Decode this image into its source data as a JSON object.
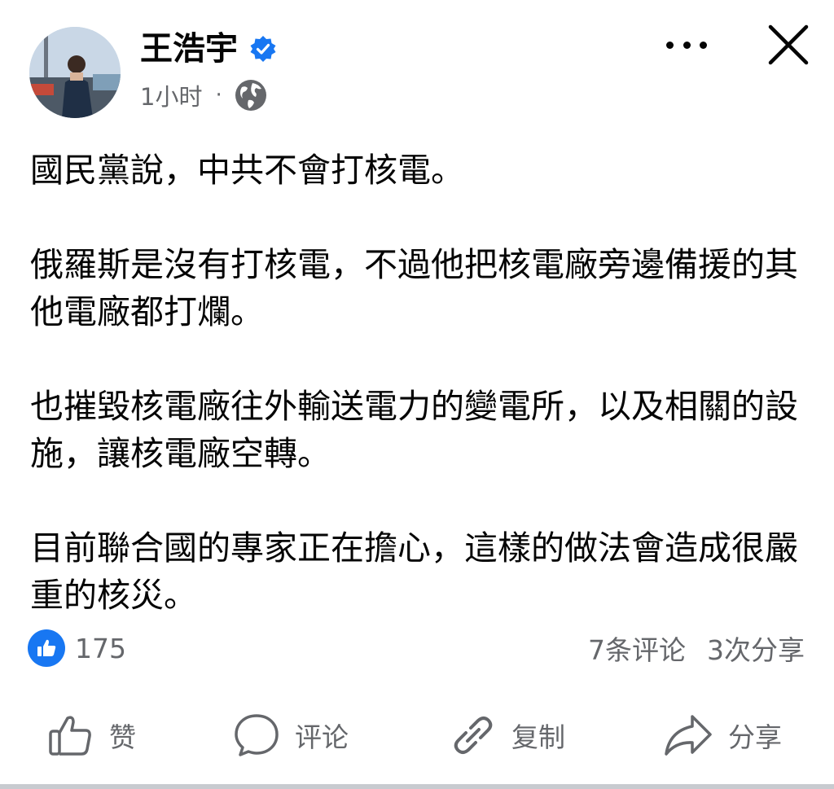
{
  "header": {
    "author_name": "王浩宇",
    "timestamp": "1小时",
    "separator": "·",
    "privacy_icon": "globe-icon",
    "verified_icon": "verified-badge-icon"
  },
  "post": {
    "paragraphs": [
      "國民黨說，中共不會打核電。",
      "俄羅斯是沒有打核電，不過他把核電廠旁邊備援的其他電廠都打爛。",
      "也摧毀核電廠往外輸送電力的變電所，以及相關的設施，讓核電廠空轉。",
      "目前聯合國的專家正在擔心，這樣的做法會造成很嚴重的核災。"
    ]
  },
  "stats": {
    "reaction_count": "175",
    "comments": "7条评论",
    "shares": "3次分享"
  },
  "actions": {
    "like_label": "赞",
    "comment_label": "评论",
    "copy_label": "复制",
    "share_label": "分享"
  },
  "colors": {
    "brand_blue": "#1877f2",
    "secondary_text": "#65676b",
    "primary_text": "#050505"
  }
}
